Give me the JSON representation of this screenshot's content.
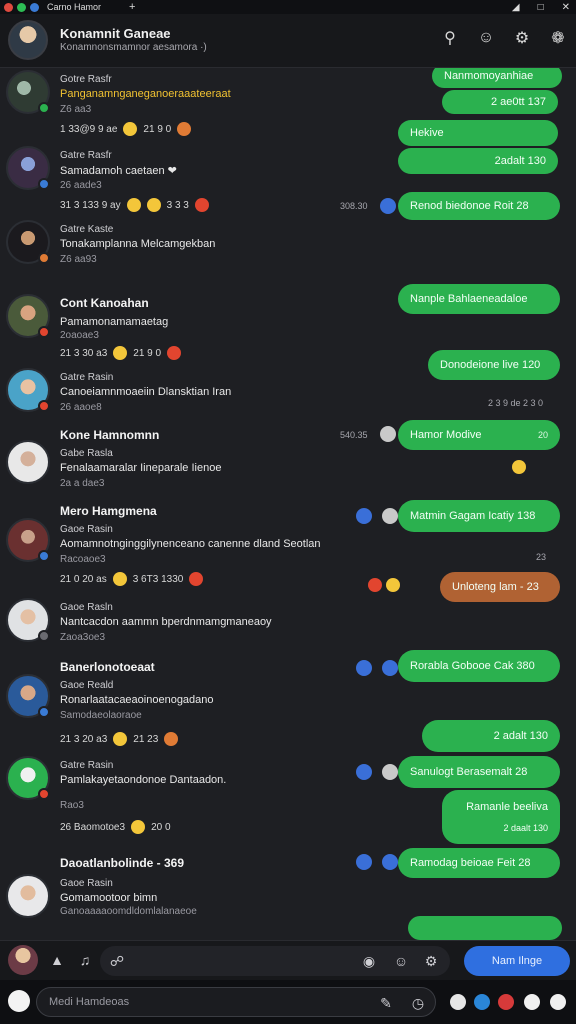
{
  "titlebar": {
    "title": "Carno Hamor",
    "plus": "+"
  },
  "header": {
    "name": "Konamnit Ganeae",
    "subtitle": "Konamnonsmamnor aesamora ·)"
  },
  "colors": {
    "accent_green": "#2bb14f",
    "accent_blue": "#2f6fe0",
    "accent_orange": "#b06233",
    "background": "#1e1f23"
  },
  "conversations": [
    {
      "name": "Gotre Rasfr",
      "message": "Panganamnganeganoeraaateeraat",
      "meta": "Z6 aa3",
      "meta2": "1 33@9 9 ae",
      "meta3": "21 9 0"
    },
    {
      "name": "Gatre Rasfr",
      "message": "Samadamoh caetaen ❤",
      "meta": "26 aade3",
      "meta2": "31 3 133 9 ay",
      "meta3": "3 3 3"
    },
    {
      "name": "Gatre Kaste",
      "message": "Tonakamplanna Melcamgekban",
      "meta": "Z6 aa93"
    },
    {
      "name": "Cont Kanoahan",
      "message": "Pamamonamamaetag",
      "meta": "2oaoae3",
      "meta2": "21 3 30 a3",
      "meta3": "21 9 0"
    },
    {
      "name": "Gatre Rasin",
      "message": "Canoeiamnmoaeiin Dlansktian Iran",
      "meta": "26 aaoe8"
    },
    {
      "name": "Kone Hamnomnn",
      "sub": "Gabe Rasla",
      "message": "Fenalaamaralar Iineparale Iienoe",
      "meta": "2a a dae3"
    },
    {
      "name": "Mero Hamgmena",
      "sub": "Gaoe Rasin",
      "message": "Aomamnotnginggilynenceano canenne dland Seotlan",
      "meta": "Racoaoe3",
      "meta2": "21 0 20 as",
      "meta3": "3 6T3 1330"
    },
    {
      "name": "Gaoe Rasln",
      "message": "Nantcacdon aammn bperdnmamgmaneaoy",
      "meta": "Zaoa3oe3"
    },
    {
      "name": "Banerlonotoeaat",
      "sub": "Gaoe Reald",
      "message": "Ronarlaatacaeaoinoenogadano",
      "meta": "Samodaeolaoraoe",
      "meta2": "21 3 20 a3",
      "meta3": "21 23"
    },
    {
      "name": "Gatre Rasin",
      "message": "Pamlakayetaondonoe Dantaadon.",
      "meta": "Rao3",
      "meta2": "26 Baomotoe3",
      "meta3": "20 0"
    },
    {
      "name": "Daoatlanbolinde - 369",
      "sub": "Gaoe Rasin",
      "message": "Gomamootoor bimn",
      "meta": "Ganoaaaaoomdldomlalanaeoe"
    }
  ],
  "sent": [
    {
      "text": "Nanmomoyanhiae",
      "time": "2 ae0tt 137"
    },
    {
      "text": "Hekive",
      "time": "2adalt 130"
    },
    {
      "text": "Renod biedonoe Roit 28",
      "side_time": "308.30"
    },
    {
      "text": "Nanple Bahlaeneadaloe"
    },
    {
      "text": "Donodeione live 120",
      "side_time": "2 3 9 de 2 3 0"
    },
    {
      "text": "Hamor Modive",
      "small": "20",
      "side_time": "540.35"
    },
    {
      "text": "Matmin Gagam Icatiy 138"
    },
    {
      "text": "Unloteng lam - 23",
      "side_time": "23"
    },
    {
      "text": "Rorabla Gobooe Cak 380"
    },
    {
      "text": "",
      "time": "2 adalt 130"
    },
    {
      "text": "Sanulogt Berasemalt 28"
    },
    {
      "text": "Ramanle beeliva",
      "time": "2 daalt 130"
    },
    {
      "text": "Ramodag beioae Feit 28"
    }
  ],
  "composer": {
    "send_label": "Nam Ilnge"
  },
  "search": {
    "placeholder": "Medi Hamdeoas"
  }
}
